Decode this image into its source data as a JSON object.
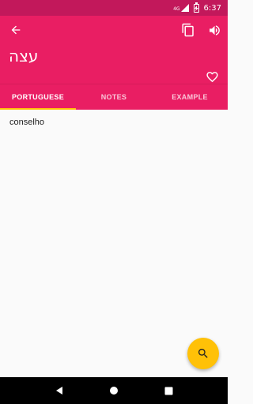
{
  "status_bar": {
    "network": "4G",
    "time": "6:37"
  },
  "header": {
    "word": "עצה"
  },
  "tabs": [
    {
      "label": "PORTUGUESE",
      "active": true
    },
    {
      "label": "NOTES",
      "active": false
    },
    {
      "label": "EXAMPLE",
      "active": false
    }
  ],
  "content": {
    "translation": "conselho"
  },
  "colors": {
    "primary": "#e91e63",
    "primary_dark": "#c2185b",
    "accent": "#ffc107"
  },
  "icons": [
    "back-arrow-icon",
    "copy-icon",
    "volume-icon",
    "heart-icon",
    "search-icon"
  ]
}
